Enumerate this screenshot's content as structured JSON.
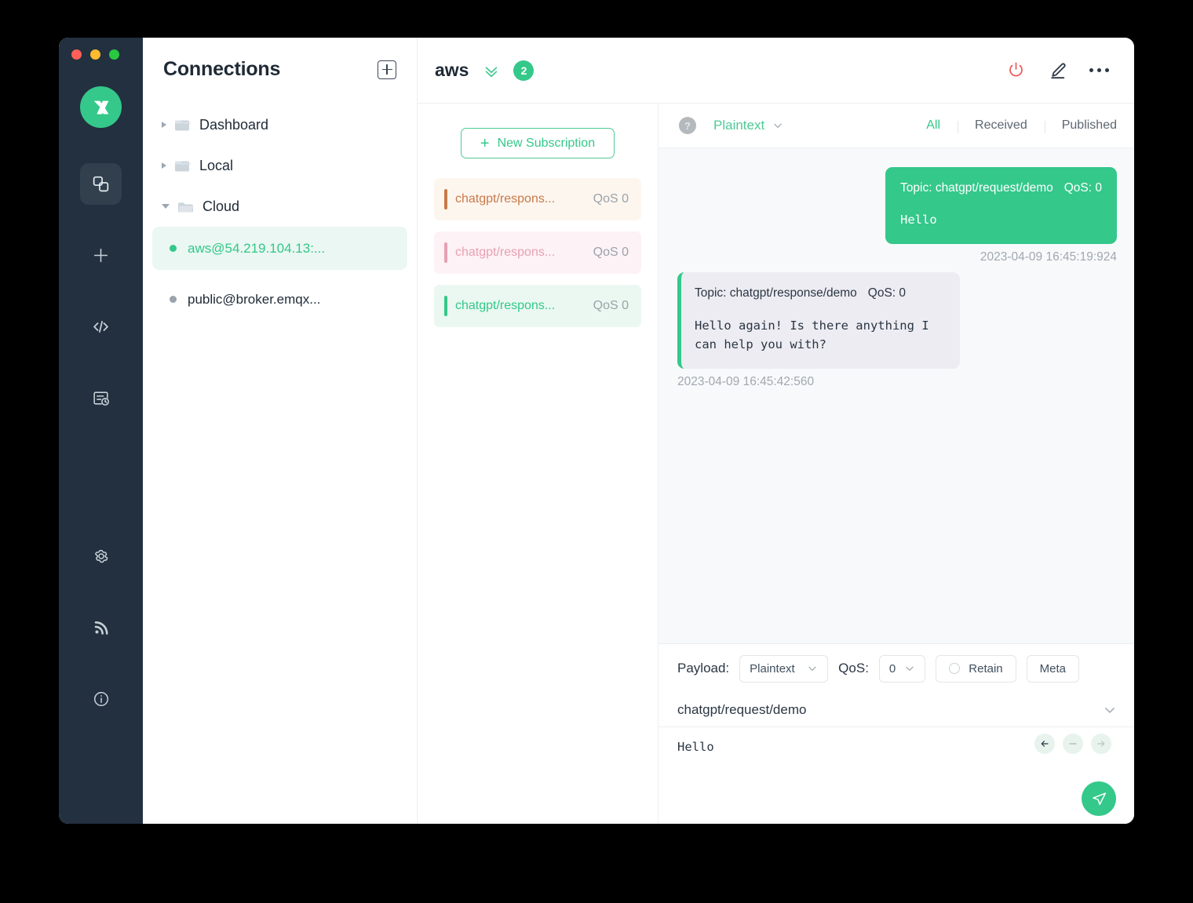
{
  "app": {
    "logo_icon": "mqttx-logo-icon",
    "window_controls": [
      "close",
      "minimize",
      "maximize"
    ]
  },
  "rail": {
    "items": [
      {
        "name": "connections",
        "icon": "connections-icon",
        "active": true
      },
      {
        "name": "new-connection",
        "icon": "plus-icon",
        "active": false
      },
      {
        "name": "scripts",
        "icon": "code-icon",
        "active": false
      },
      {
        "name": "log",
        "icon": "log-icon",
        "active": false
      },
      {
        "name": "settings",
        "icon": "gear-icon",
        "active": false
      },
      {
        "name": "broadcast",
        "icon": "signal-icon",
        "active": false
      },
      {
        "name": "about",
        "icon": "info-icon",
        "active": false
      }
    ]
  },
  "connections": {
    "title": "Connections",
    "add_icon": "add-connection-icon",
    "groups": [
      {
        "label": "Dashboard",
        "expanded": false,
        "icon": "folder-closed-icon"
      },
      {
        "label": "Local",
        "expanded": false,
        "icon": "folder-closed-icon"
      },
      {
        "label": "Cloud",
        "expanded": true,
        "icon": "folder-open-icon"
      }
    ],
    "items": [
      {
        "label": "aws@54.219.104.13:...",
        "status": "connected",
        "active": true,
        "dot_color": "#34c88a"
      },
      {
        "label": "public@broker.emqx...",
        "status": "disconnected",
        "active": false,
        "dot_color": "#9aa3ab"
      }
    ]
  },
  "topbar": {
    "title": "aws",
    "collapse_icon": "double-chevron-down-icon",
    "badge": "2",
    "power_icon": "power-icon",
    "edit_icon": "edit-pencil-icon",
    "more_icon": "more-dots-icon",
    "power_color": "#f05a5a"
  },
  "subscriptions": {
    "new_label": "New Subscription",
    "new_icon": "plus-icon",
    "items": [
      {
        "topic": "chatgpt/respons...",
        "qos": "QoS 0",
        "color": "#c8794a",
        "bg": "#fdf6ef"
      },
      {
        "topic": "chatgpt/respons...",
        "qos": "QoS 0",
        "color": "#e8a0b4",
        "bg": "#fdf2f5"
      },
      {
        "topic": "chatgpt/respons...",
        "qos": "QoS 0",
        "color": "#34c88a",
        "bg": "#eaf8f1"
      }
    ]
  },
  "messages_toolbar": {
    "help_icon": "question-mark-icon",
    "format": "Plaintext",
    "format_chevron_icon": "chevron-down-icon",
    "filters": [
      {
        "label": "All",
        "active": true
      },
      {
        "label": "Received",
        "active": false
      },
      {
        "label": "Published",
        "active": false
      }
    ]
  },
  "messages": [
    {
      "direction": "out",
      "topic_line": "Topic: chatgpt/request/demo",
      "qos_line": "QoS: 0",
      "payload": "Hello",
      "timestamp": "2023-04-09 16:45:19:924"
    },
    {
      "direction": "in",
      "topic_line": "Topic: chatgpt/response/demo",
      "qos_line": "QoS: 0",
      "payload": "Hello again! Is there anything I can help you with?",
      "timestamp": "2023-04-09 16:45:42:560"
    }
  ],
  "publish": {
    "payload_label": "Payload:",
    "payload_value": "Plaintext",
    "qos_label": "QoS:",
    "qos_value": "0",
    "retain_label": "Retain",
    "retain_checked": false,
    "meta_label": "Meta",
    "topic_value": "chatgpt/request/demo",
    "topic_chevron_icon": "chevron-down-icon",
    "editor_value": "Hello",
    "nav": [
      {
        "icon": "arrow-left-icon",
        "enabled": true
      },
      {
        "icon": "minus-icon",
        "enabled": false
      },
      {
        "icon": "arrow-right-icon",
        "enabled": false
      }
    ],
    "send_icon": "send-icon"
  },
  "colors": {
    "accent": "#34c88a",
    "rail_bg": "#22303f",
    "msg_bg": "#f8f9fb",
    "danger": "#f05a5a"
  }
}
